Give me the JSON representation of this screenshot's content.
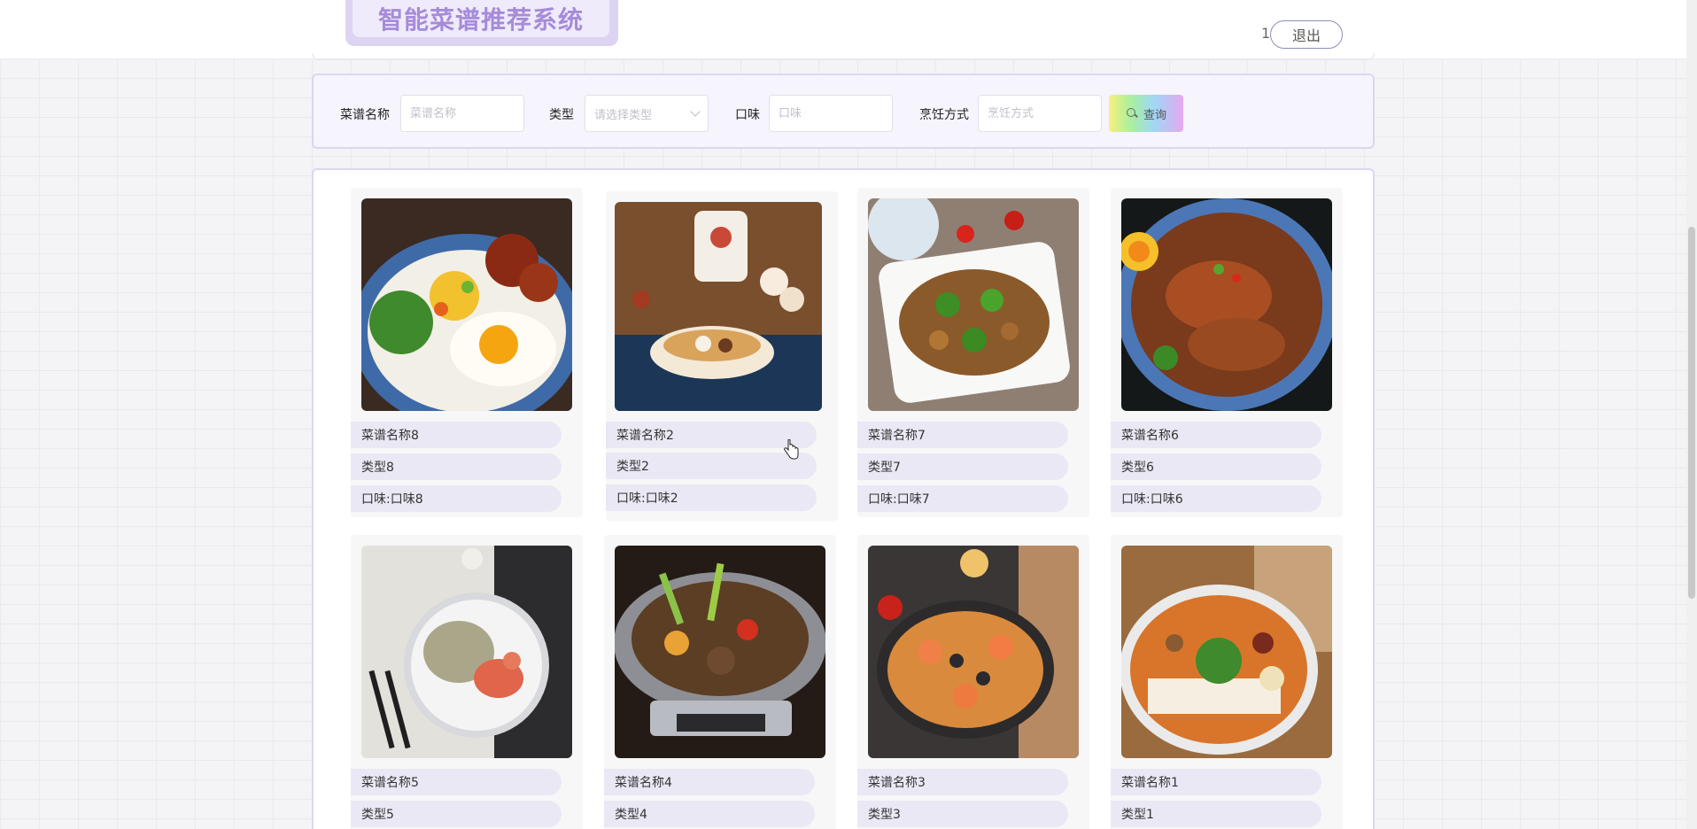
{
  "header": {
    "title": "智能菜谱推荐系统",
    "user_number": "1",
    "logout_label": "退出"
  },
  "search": {
    "name_label": "菜谱名称",
    "name_placeholder": "菜谱名称",
    "type_label": "类型",
    "type_placeholder": "请选择类型",
    "flavor_label": "口味",
    "flavor_placeholder": "口味",
    "method_label": "烹饪方式",
    "method_placeholder": "烹饪方式",
    "button_label": "查询"
  },
  "recipes": [
    {
      "name": "菜谱名称8",
      "type": "类型8",
      "flavor": "口味:口味8",
      "image": "braised-pork-rice-bowl"
    },
    {
      "name": "菜谱名称2",
      "type": "类型2",
      "flavor": "口味:口味2",
      "image": "soup-bowl"
    },
    {
      "name": "菜谱名称7",
      "type": "类型7",
      "flavor": "口味:口味7",
      "image": "stir-fry-green-pepper"
    },
    {
      "name": "菜谱名称6",
      "type": "类型6",
      "flavor": "口味:口味6",
      "image": "braised-chicken-bowl"
    },
    {
      "name": "菜谱名称5",
      "type": "类型5",
      "flavor": "",
      "image": "shrimp-rice-plate"
    },
    {
      "name": "菜谱名称4",
      "type": "类型4",
      "flavor": "",
      "image": "dry-pot"
    },
    {
      "name": "菜谱名称3",
      "type": "类型3",
      "flavor": "",
      "image": "seafood-paella"
    },
    {
      "name": "菜谱名称1",
      "type": "类型1",
      "flavor": "",
      "image": "rice-noodle-soup"
    }
  ],
  "colors": {
    "title_text": "#a68bd9",
    "title_bg": "#dcd4f2",
    "panel_border": "#dcd6f1",
    "pill_bg": "#ebe8f5"
  }
}
